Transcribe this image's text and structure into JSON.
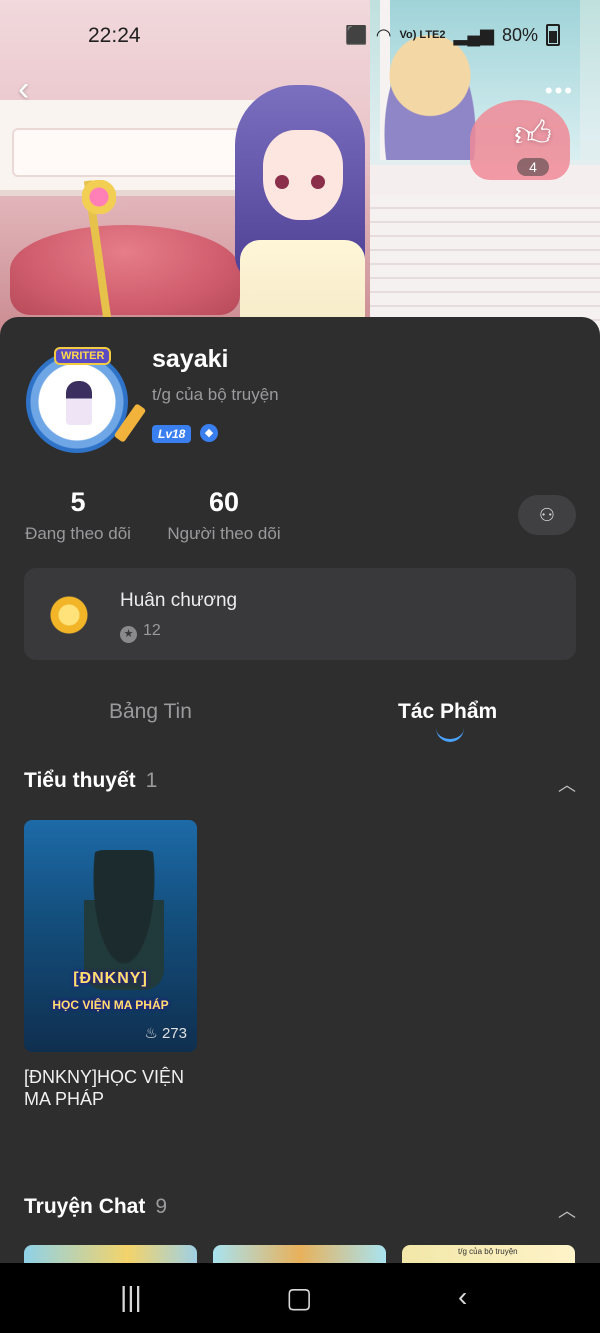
{
  "status_bar": {
    "time": "22:24",
    "network": "Vo) LTE2",
    "battery": "80%"
  },
  "hero": {
    "like_count": "4"
  },
  "profile": {
    "avatar_tag": "WRITER",
    "username": "sayaki",
    "subtitle": "t/g của bộ truyện",
    "level": "Lv18"
  },
  "stats": [
    {
      "value": "5",
      "label": "Đang theo dõi"
    },
    {
      "value": "60",
      "label": "Người theo dõi"
    }
  ],
  "medals": {
    "title": "Huân chương",
    "count": "12"
  },
  "tabs": [
    {
      "label": "Bảng Tin",
      "active": false
    },
    {
      "label": "Tác Phẩm",
      "active": true
    }
  ],
  "novels": {
    "title": "Tiểu thuyết",
    "count": "1",
    "items": [
      {
        "cover_title": "[ĐNKNY]",
        "cover_subtitle": "HỌC VIỆN MA PHÁP",
        "likes": "273",
        "name": "[ĐNKNY]HỌC VIỆN MA PHÁP"
      }
    ]
  },
  "chats": {
    "title": "Truyện Chat",
    "count": "9",
    "thumb3_text": "t/g của bộ truyện"
  },
  "colors": {
    "panel": "#2e2e2f",
    "card": "#39393b",
    "accent_blue": "#4aa3ff",
    "muted_text": "#9a9a9c"
  },
  "icons": [
    "back-icon",
    "more-icon",
    "thumbs-up-icon",
    "follow-user-icon",
    "medal-icon",
    "star-icon",
    "chevron-up-icon",
    "fire-icon",
    "recent-apps-icon",
    "home-icon",
    "back-nav-icon"
  ]
}
